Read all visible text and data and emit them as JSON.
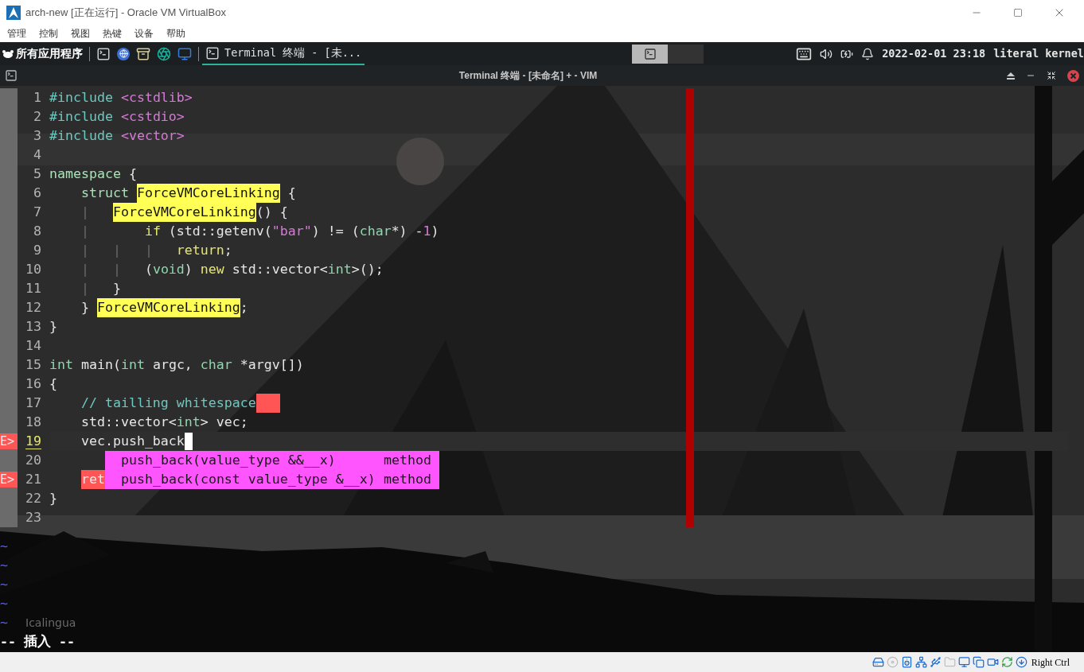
{
  "window": {
    "title": "arch-new [正在运行] - Oracle VM VirtualBox",
    "menu": [
      "管理",
      "控制",
      "视图",
      "热键",
      "设备",
      "帮助"
    ]
  },
  "taskbar": {
    "launcher": "所有应用程序",
    "task": {
      "label": "Terminal 终端 - [未...",
      "selected": true
    },
    "workspaces": [
      {
        "selected": true
      },
      {
        "selected": false
      }
    ],
    "clock": "2022-02-01 23:18",
    "user": "literal kernel"
  },
  "terminal": {
    "title": "Terminal 终端 - [未命名] + - VIM"
  },
  "editor": {
    "lines": [
      {
        "number": "1",
        "current": false,
        "segments": [
          {
            "text": "#include ",
            "kind": "pre"
          },
          {
            "text": "<cstdlib>",
            "kind": "inc"
          }
        ]
      },
      {
        "number": "2",
        "current": false,
        "segments": [
          {
            "text": "#include ",
            "kind": "pre"
          },
          {
            "text": "<cstdio>",
            "kind": "inc"
          }
        ]
      },
      {
        "number": "3",
        "current": false,
        "segments": [
          {
            "text": "#include ",
            "kind": "pre"
          },
          {
            "text": "<vector>",
            "kind": "inc"
          }
        ]
      },
      {
        "number": "4",
        "current": false
      },
      {
        "number": "5",
        "current": false,
        "segments": [
          {
            "text": "namespace",
            "kind": "kw"
          },
          {
            "text": " {",
            "kind": "plain"
          }
        ]
      },
      {
        "number": "6",
        "current": false,
        "segments": [
          {
            "text": "    struct ",
            "kind": "kw"
          },
          {
            "text": "ForceVMCoreLinking",
            "kind": "hl"
          },
          {
            "text": " {",
            "kind": "plain"
          }
        ]
      },
      {
        "number": "7",
        "current": false,
        "segments": [
          {
            "text": "    |   ",
            "kind": "guide"
          },
          {
            "text": "ForceVMCoreLinking",
            "kind": "hl"
          },
          {
            "text": "() {",
            "kind": "plain"
          }
        ]
      },
      {
        "number": "8",
        "current": false,
        "segments": [
          {
            "text": "    |       ",
            "kind": "guide"
          },
          {
            "text": "if",
            "kind": "ctl"
          },
          {
            "text": " (std::getenv(",
            "kind": "plain"
          },
          {
            "text": "\"bar\"",
            "kind": "str"
          },
          {
            "text": ") != (",
            "kind": "plain"
          },
          {
            "text": "char",
            "kind": "type"
          },
          {
            "text": "*) -",
            "kind": "plain"
          },
          {
            "text": "1",
            "kind": "str"
          },
          {
            "text": ")",
            "kind": "plain"
          }
        ]
      },
      {
        "number": "9",
        "current": false,
        "segments": [
          {
            "text": "    |   |   |   ",
            "kind": "guide"
          },
          {
            "text": "return",
            "kind": "ctl"
          },
          {
            "text": ";",
            "kind": "plain"
          }
        ]
      },
      {
        "number": "10",
        "current": false,
        "segments": [
          {
            "text": "    |   |   ",
            "kind": "guide"
          },
          {
            "text": "(",
            "kind": "plain"
          },
          {
            "text": "void",
            "kind": "type"
          },
          {
            "text": ") ",
            "kind": "plain"
          },
          {
            "text": "new",
            "kind": "ctl"
          },
          {
            "text": " std::vector<",
            "kind": "plain"
          },
          {
            "text": "int",
            "kind": "type"
          },
          {
            "text": ">();",
            "kind": "plain"
          }
        ]
      },
      {
        "number": "11",
        "current": false,
        "segments": [
          {
            "text": "    |   ",
            "kind": "guide"
          },
          {
            "text": "}",
            "kind": "plain"
          }
        ]
      },
      {
        "number": "12",
        "current": false,
        "segments": [
          {
            "text": "    } ",
            "kind": "plain"
          },
          {
            "text": "ForceVMCoreLinking",
            "kind": "hl"
          },
          {
            "text": ";",
            "kind": "plain"
          }
        ]
      },
      {
        "number": "13",
        "current": false,
        "segments": [
          {
            "text": "}",
            "kind": "plain"
          }
        ]
      },
      {
        "number": "14",
        "current": false
      },
      {
        "number": "15",
        "current": false,
        "segments": [
          {
            "text": "int",
            "kind": "type"
          },
          {
            "text": " main(",
            "kind": "plain"
          },
          {
            "text": "int",
            "kind": "type"
          },
          {
            "text": " argc, ",
            "kind": "plain"
          },
          {
            "text": "char",
            "kind": "type"
          },
          {
            "text": " *argv[])",
            "kind": "plain"
          }
        ]
      },
      {
        "number": "16",
        "current": false,
        "segments": [
          {
            "text": "{",
            "kind": "plain"
          }
        ]
      },
      {
        "number": "17",
        "current": false,
        "trailing_whitespace": true,
        "segments": [
          {
            "text": "    // tailling whitespace",
            "kind": "comment"
          }
        ]
      },
      {
        "number": "18",
        "current": false,
        "segments": [
          {
            "text": "    std::vector<",
            "kind": "plain"
          },
          {
            "text": "int",
            "kind": "type"
          },
          {
            "text": "> vec;",
            "kind": "plain"
          }
        ]
      },
      {
        "number": "19",
        "current": true,
        "sign": "E>",
        "cursor": true,
        "segments": [
          {
            "text": "    vec.push_back",
            "kind": "plain"
          }
        ]
      },
      {
        "number": "20",
        "current": false
      },
      {
        "number": "21",
        "current": false,
        "sign": "E>",
        "indented": true,
        "segments": [
          {
            "text": "ret",
            "kind": "error"
          }
        ]
      },
      {
        "number": "22",
        "current": false,
        "segments": [
          {
            "text": "}",
            "kind": "plain"
          }
        ]
      },
      {
        "number": "23",
        "current": false
      }
    ],
    "completion": [
      {
        "label": "push_back(value_type &&__x)",
        "kind": "method",
        "selected": false
      },
      {
        "label": "push_back(const value_type &__x)",
        "kind": "method",
        "selected": false
      }
    ],
    "tildes": [
      "~",
      "~",
      "~",
      "~",
      "~"
    ],
    "mode": "-- 插入 --"
  },
  "desktop_label": "Icalingua",
  "statusbar": {
    "host_key": "Right Ctrl"
  }
}
